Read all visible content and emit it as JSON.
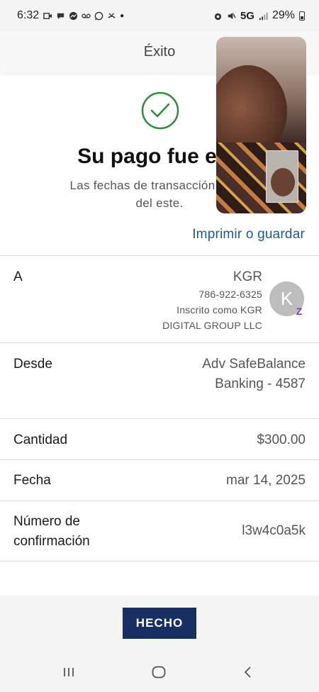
{
  "status_bar": {
    "time": "6:32",
    "network": "5G",
    "battery": "29%"
  },
  "header": {
    "title": "Éxito"
  },
  "success": {
    "headline": "Su pago fue env",
    "subtext_line1": "Las fechas de transacción se ba",
    "subtext_line2": "del este."
  },
  "print_link": "Imprimir o guardar",
  "details": {
    "to": {
      "label": "A",
      "name": "KGR",
      "phone": "786-922-6325",
      "enrolled_line1": "Inscrito como KGR",
      "enrolled_line2": "DIGITAL GROUP LLC",
      "avatar_letter": "K"
    },
    "from": {
      "label": "Desde",
      "value_line1": "Adv SafeBalance",
      "value_line2": "Banking - 4587"
    },
    "amount": {
      "label": "Cantidad",
      "value": "$300.00"
    },
    "date": {
      "label": "Fecha",
      "value": "mar 14, 2025"
    },
    "confirmation": {
      "label_line1": "Número de",
      "label_line2": "confirmación",
      "value": "l3w4c0a5k"
    }
  },
  "done_button": "HECHO",
  "colors": {
    "accent_link": "#1e5a86",
    "button": "#172f62",
    "success_check": "#2e8b3a",
    "zelle": "#7a3cc8"
  }
}
